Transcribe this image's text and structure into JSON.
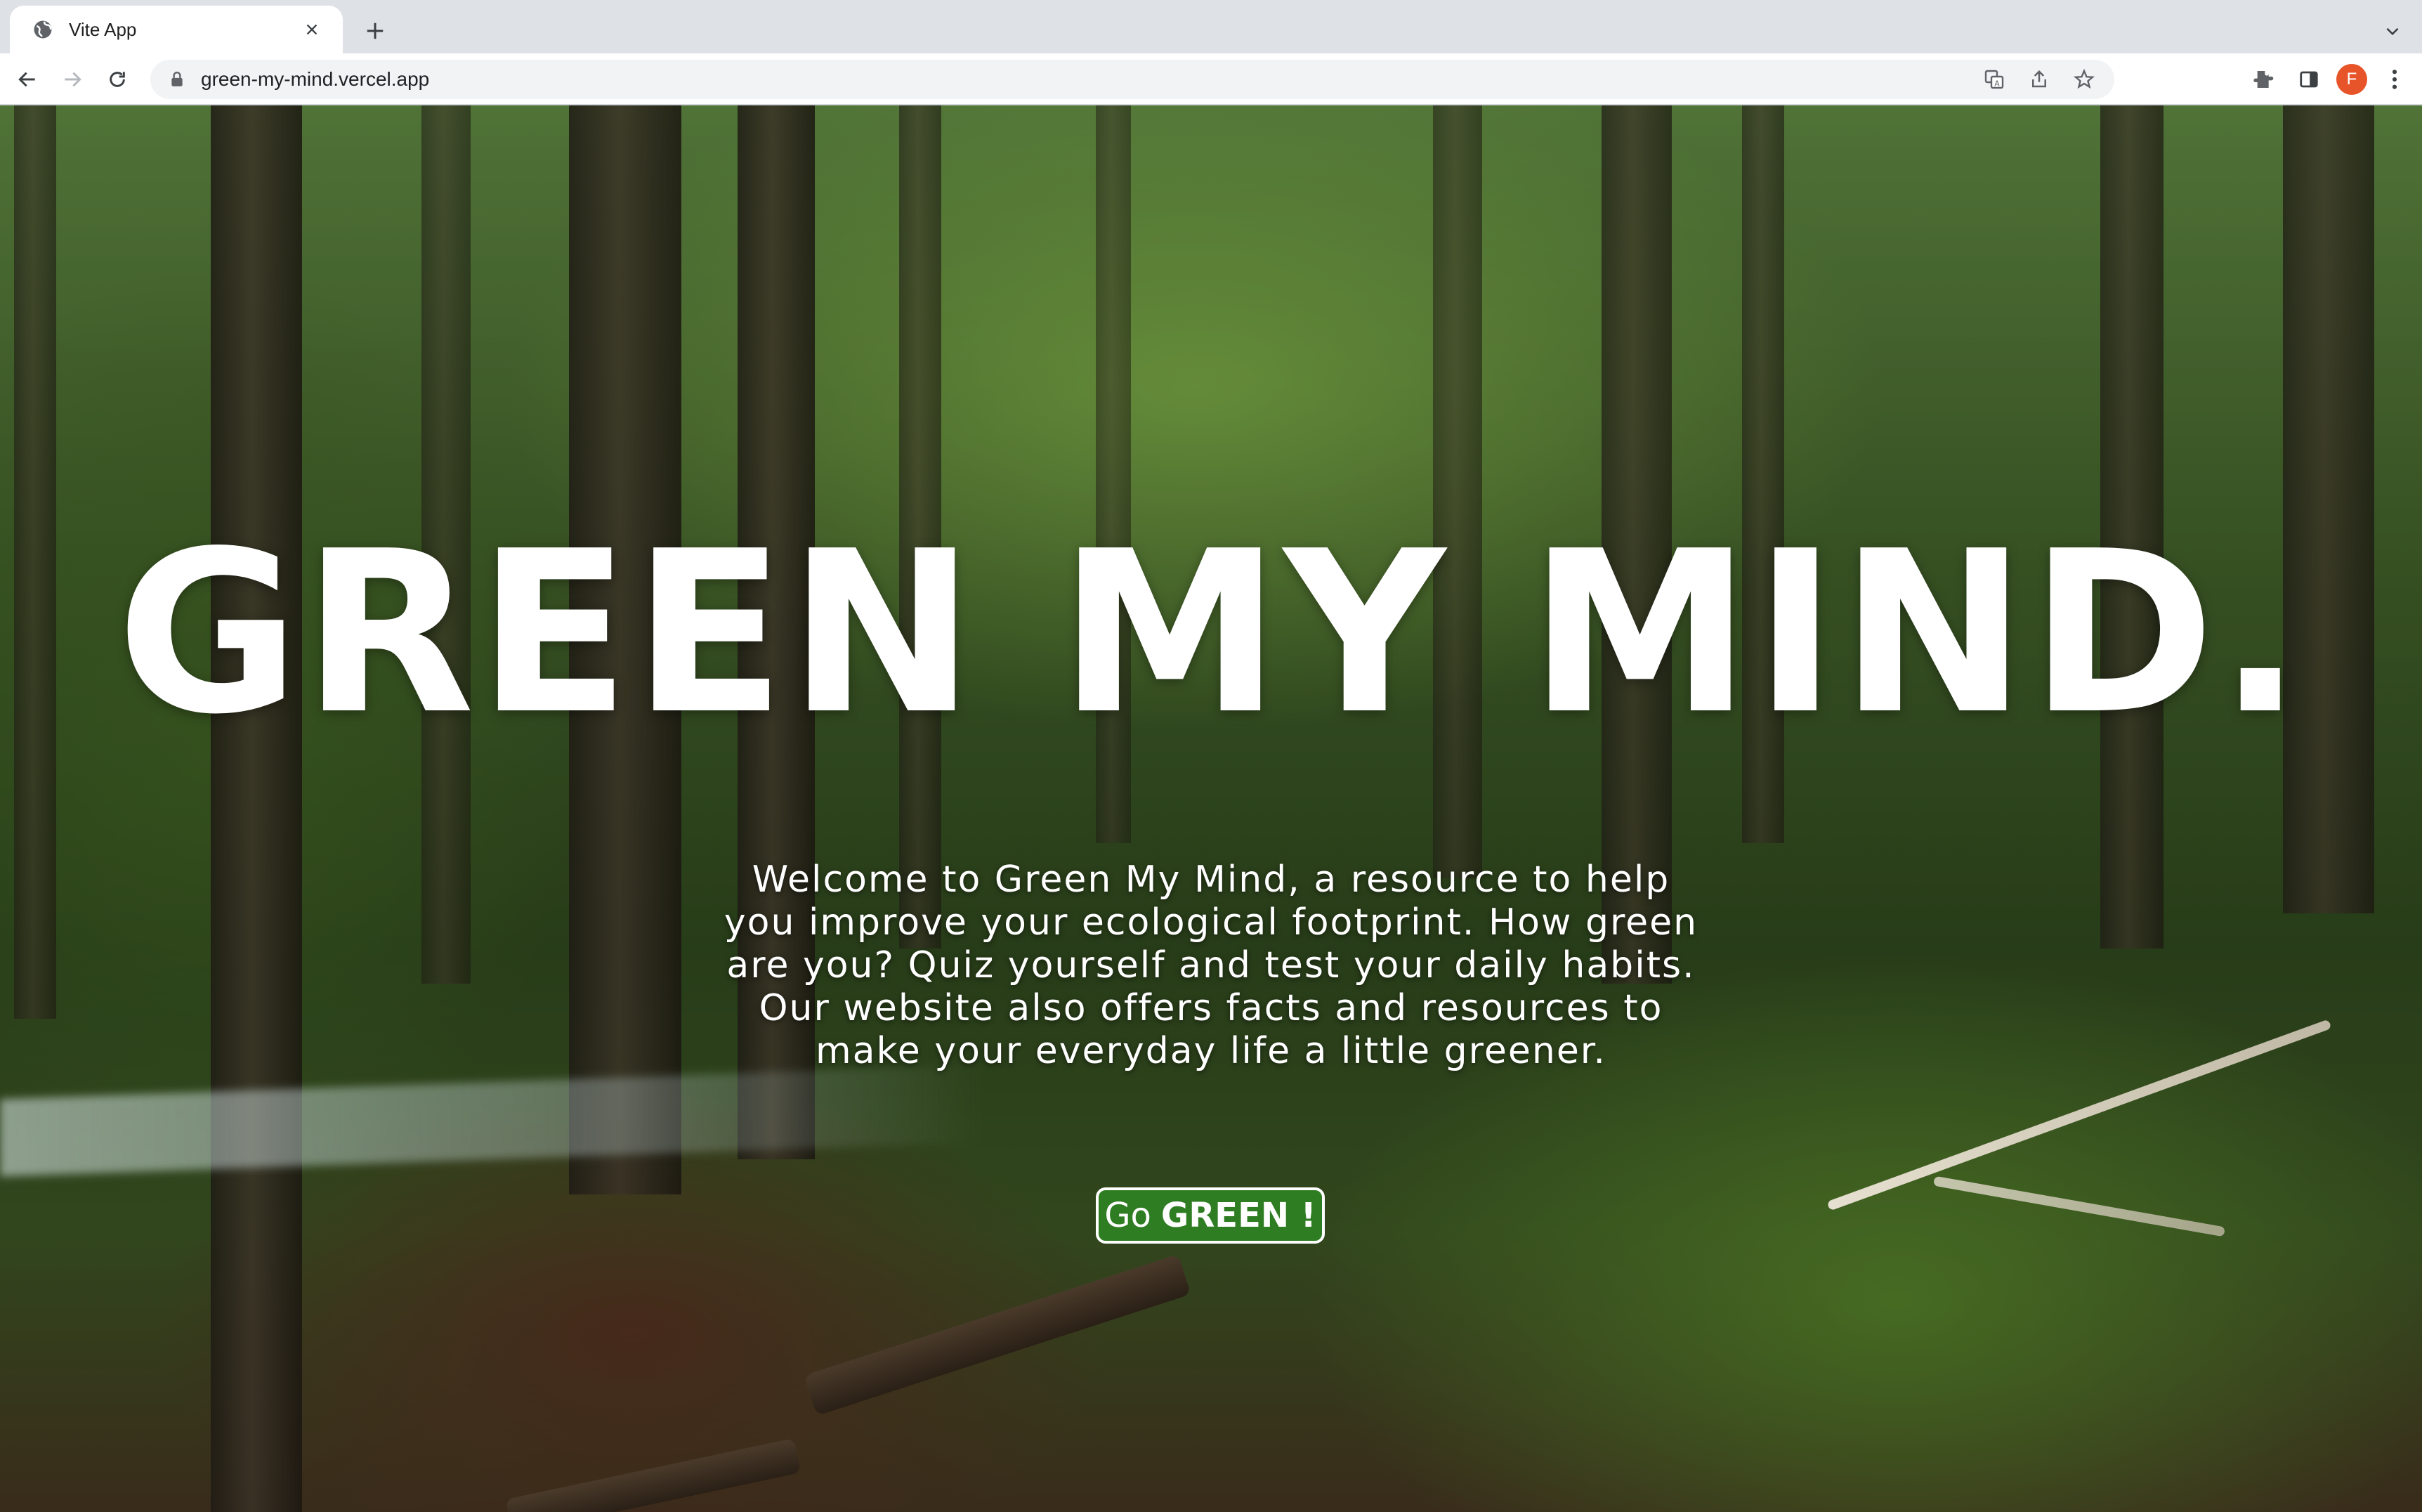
{
  "browser": {
    "tab": {
      "title": "Vite App",
      "favicon": "globe-icon"
    },
    "url": "green-my-mind.vercel.app",
    "profile_initial": "F",
    "accent": "#e8542a"
  },
  "hero": {
    "title": "GREEN MY MIND.",
    "intro": "Welcome to Green My Mind, a resource to help you improve your ecological footprint. How green are you? Quiz yourself and test your daily habits. Our website also offers facts and resources to make your everyday life a little greener.",
    "cta": {
      "prefix": "Go",
      "emphasis": "GREEN !"
    },
    "button_color": "#2f7d22",
    "background": "forest-video"
  }
}
